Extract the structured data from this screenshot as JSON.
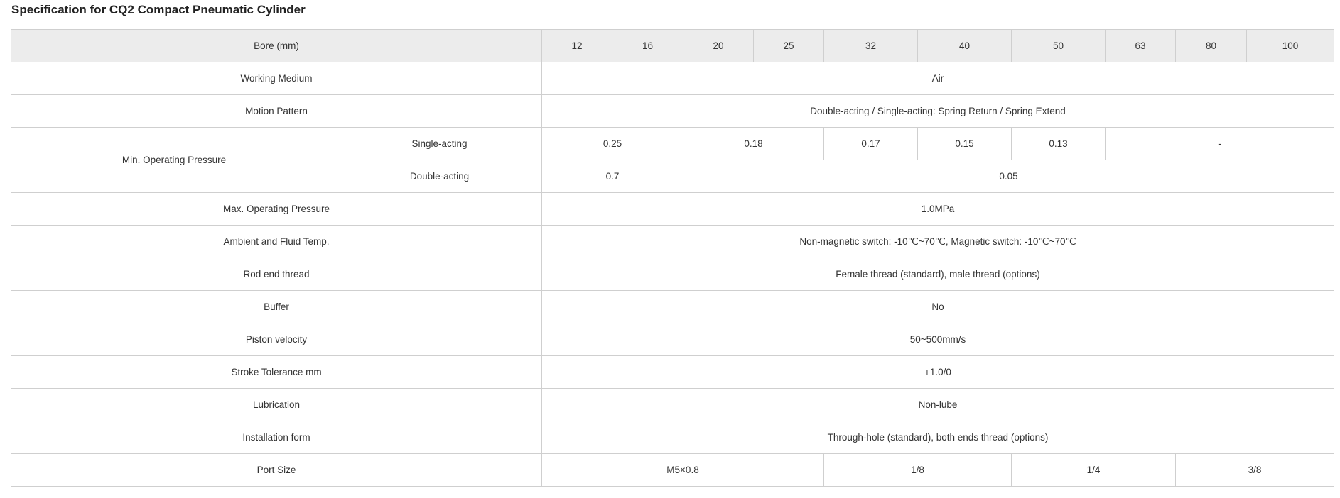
{
  "title": "Specification for CQ2 Compact Pneumatic Cylinder",
  "colors": {
    "header_bg": "#ececec",
    "border": "#cfcfcf",
    "text": "#333333"
  },
  "header": {
    "label": "Bore (mm)",
    "bores": [
      "12",
      "16",
      "20",
      "25",
      "32",
      "40",
      "50",
      "63",
      "80",
      "100"
    ]
  },
  "rows": {
    "working_medium": {
      "label": "Working Medium",
      "value": "Air"
    },
    "motion_pattern": {
      "label": "Motion Pattern",
      "value": "Double-acting / Single-acting: Spring Return / Spring Extend"
    },
    "min_pressure": {
      "label": "Min. Operating Pressure",
      "single": {
        "label": "Single-acting",
        "values": [
          "0.25",
          "0.18",
          "0.17",
          "0.15",
          "0.13",
          "-"
        ]
      },
      "double": {
        "label": "Double-acting",
        "values": [
          "0.7",
          "0.05"
        ]
      }
    },
    "max_pressure": {
      "label": "Max. Operating Pressure",
      "value": "1.0MPa"
    },
    "ambient_temp": {
      "label": "Ambient and Fluid Temp.",
      "value": "Non-magnetic switch: -10℃~70℃, Magnetic switch: -10℃~70℃"
    },
    "rod_end_thread": {
      "label": "Rod end thread",
      "value": "Female thread (standard), male thread (options)"
    },
    "buffer": {
      "label": "Buffer",
      "value": "No"
    },
    "piston_velocity": {
      "label": "Piston velocity",
      "value": "50~500mm/s"
    },
    "stroke_tolerance": {
      "label": "Stroke Tolerance mm",
      "value": "+1.0/0"
    },
    "lubrication": {
      "label": "Lubrication",
      "value": "Non-lube"
    },
    "installation_form": {
      "label": "Installation form",
      "value": "Through-hole (standard), both ends thread (options)"
    },
    "port_size": {
      "label": "Port Size",
      "values": [
        "M5×0.8",
        "1/8",
        "1/4",
        "3/8"
      ]
    }
  }
}
